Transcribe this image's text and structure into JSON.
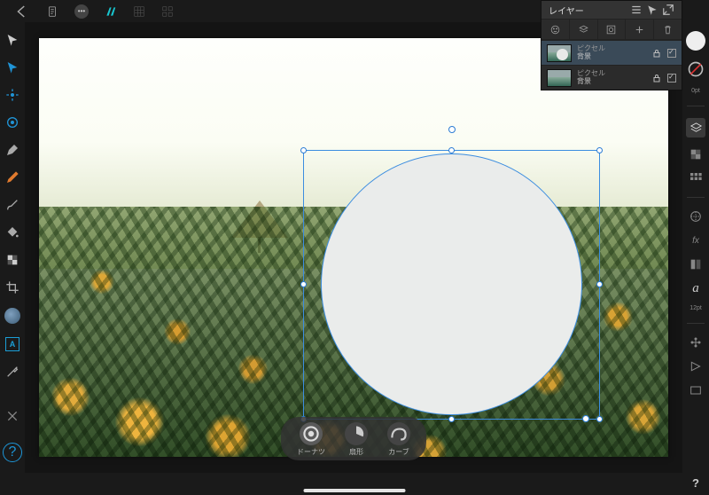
{
  "topbar": {
    "back": "←"
  },
  "rightcol": {
    "stroke_label": "0pt",
    "font_size_label": "12pt"
  },
  "shape_options": {
    "donut": "ドーナツ",
    "fan": "扇形",
    "curve": "カーブ"
  },
  "layers_panel": {
    "title": "レイヤー",
    "layer1_type": "ピクセル",
    "layer1_name": "背景",
    "layer2_type": "ピクセル",
    "layer2_name": "背景"
  },
  "help": "?"
}
